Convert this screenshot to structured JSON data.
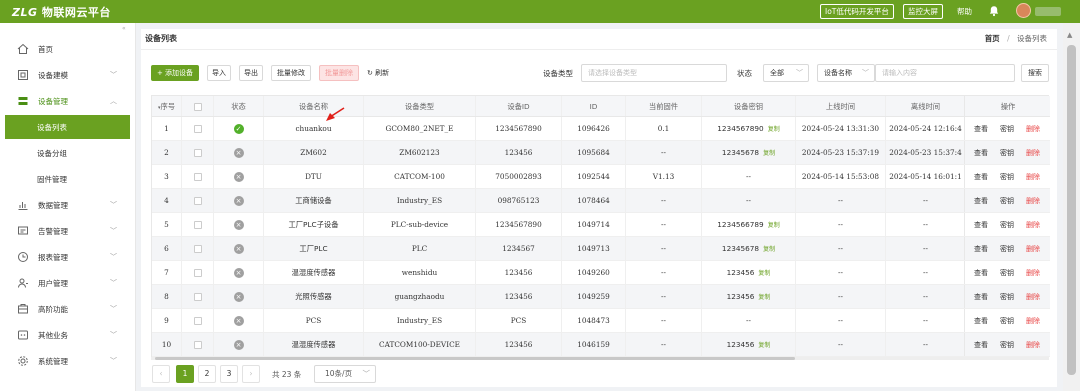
{
  "app": {
    "logo_brand": "ZLG",
    "logo_title": "物联网云平台",
    "lowcode_button": "IoT低代码开发平台",
    "monitor_button": "监控大屏",
    "help": "帮助"
  },
  "sidebar": {
    "items": [
      {
        "label": "首页",
        "icon": "home-icon",
        "has_chevron": false
      },
      {
        "label": "设备建模",
        "icon": "model-icon",
        "has_chevron": true
      },
      {
        "label": "设备管理",
        "icon": "device-manage-icon",
        "has_chevron": true,
        "active": true
      },
      {
        "label": "数据管理",
        "icon": "bar-chart-icon",
        "has_chevron": true
      },
      {
        "label": "告警管理",
        "icon": "alarm-icon",
        "has_chevron": true
      },
      {
        "label": "报表管理",
        "icon": "report-icon",
        "has_chevron": true
      },
      {
        "label": "用户管理",
        "icon": "user-icon",
        "has_chevron": true
      },
      {
        "label": "高阶功能",
        "icon": "advanced-icon",
        "has_chevron": true
      },
      {
        "label": "其他业务",
        "icon": "other-icon",
        "has_chevron": true
      },
      {
        "label": "系统管理",
        "icon": "gear-icon",
        "has_chevron": true
      }
    ],
    "subitems": [
      {
        "label": "设备列表",
        "selected": true
      },
      {
        "label": "设备分组",
        "selected": false
      },
      {
        "label": "固件管理",
        "selected": false
      }
    ]
  },
  "page": {
    "title": "设备列表",
    "breadcrumb_home": "首页",
    "breadcrumb_sep": "/",
    "breadcrumb_current": "设备列表"
  },
  "toolbar": {
    "add": "+ 添加设备",
    "import": "导入",
    "export": "导出",
    "batch_edit": "批量修改",
    "batch_delete": "批量删除",
    "refresh": "刷新"
  },
  "filters": {
    "type_label": "设备类型",
    "type_placeholder": "请选择设备类型",
    "status_label": "状态",
    "status_value": "全部",
    "name_select": "设备名称",
    "name_placeholder": "请输入内容",
    "search": "搜索"
  },
  "table": {
    "columns": [
      "序号",
      "",
      "状态",
      "设备名称",
      "设备类型",
      "设备ID",
      "ID",
      "当前固件",
      "设备密钥",
      "上线时间",
      "离线时间",
      "操作"
    ],
    "actions": {
      "view": "查看",
      "key": "密钥",
      "delete": "删除"
    },
    "copy_label": "复制",
    "rows": [
      {
        "no": "1",
        "status": "online",
        "name": "chuankou",
        "type": "GCOM80_2NET_E",
        "device_id": "1234567890",
        "id": "1096426",
        "firmware": "0.1",
        "key": "1234567890",
        "copy": true,
        "online": "2024-05-24 13:31:30",
        "offline": "2024-05-24 12:16:4"
      },
      {
        "no": "2",
        "status": "offline",
        "name": "ZM602",
        "type": "ZM602123",
        "device_id": "123456",
        "id": "1095684",
        "firmware": "--",
        "key": "12345678",
        "copy": true,
        "online": "2024-05-23 15:37:19",
        "offline": "2024-05-23 15:37:4"
      },
      {
        "no": "3",
        "status": "offline",
        "name": "DTU",
        "type": "CATCOM-100",
        "device_id": "7050002893",
        "id": "1092544",
        "firmware": "V1.13",
        "key": "--",
        "copy": false,
        "online": "2024-05-14 15:53:08",
        "offline": "2024-05-14 16:01:1"
      },
      {
        "no": "4",
        "status": "offline",
        "name": "工商储设备",
        "type": "Industry_ES",
        "device_id": "098765123",
        "id": "1078464",
        "firmware": "--",
        "key": "--",
        "copy": false,
        "online": "--",
        "offline": "--"
      },
      {
        "no": "5",
        "status": "offline",
        "name": "工厂PLC子设备",
        "type": "PLC-sub-device",
        "device_id": "1234567890",
        "id": "1049714",
        "firmware": "--",
        "key": "1234566789",
        "copy": true,
        "online": "--",
        "offline": "--"
      },
      {
        "no": "6",
        "status": "offline",
        "name": "工厂PLC",
        "type": "PLC",
        "device_id": "1234567",
        "id": "1049713",
        "firmware": "--",
        "key": "12345678",
        "copy": true,
        "online": "--",
        "offline": "--"
      },
      {
        "no": "7",
        "status": "offline",
        "name": "温湿度传感器",
        "type": "wenshidu",
        "device_id": "123456",
        "id": "1049260",
        "firmware": "--",
        "key": "123456",
        "copy": true,
        "online": "--",
        "offline": "--"
      },
      {
        "no": "8",
        "status": "offline",
        "name": "光照传感器",
        "type": "guangzhaodu",
        "device_id": "123456",
        "id": "1049259",
        "firmware": "--",
        "key": "123456",
        "copy": true,
        "online": "--",
        "offline": "--"
      },
      {
        "no": "9",
        "status": "offline",
        "name": "PCS",
        "type": "Industry_ES",
        "device_id": "PCS",
        "id": "1048473",
        "firmware": "--",
        "key": "--",
        "copy": false,
        "online": "--",
        "offline": "--"
      },
      {
        "no": "10",
        "status": "offline",
        "name": "温湿度传感器",
        "type": "CATCOM100-DEVICE",
        "device_id": "123456",
        "id": "1046159",
        "firmware": "--",
        "key": "123456",
        "copy": true,
        "online": "--",
        "offline": "--"
      }
    ]
  },
  "pagination": {
    "pages": [
      "1",
      "2",
      "3"
    ],
    "current": "1",
    "prev": "‹",
    "next": "›",
    "total": "共 23 条",
    "page_size": "10条/页"
  },
  "colors": {
    "brand": "#6aa121",
    "danger": "#e84545",
    "online": "#52b02a",
    "offline": "#a0a0a0"
  }
}
